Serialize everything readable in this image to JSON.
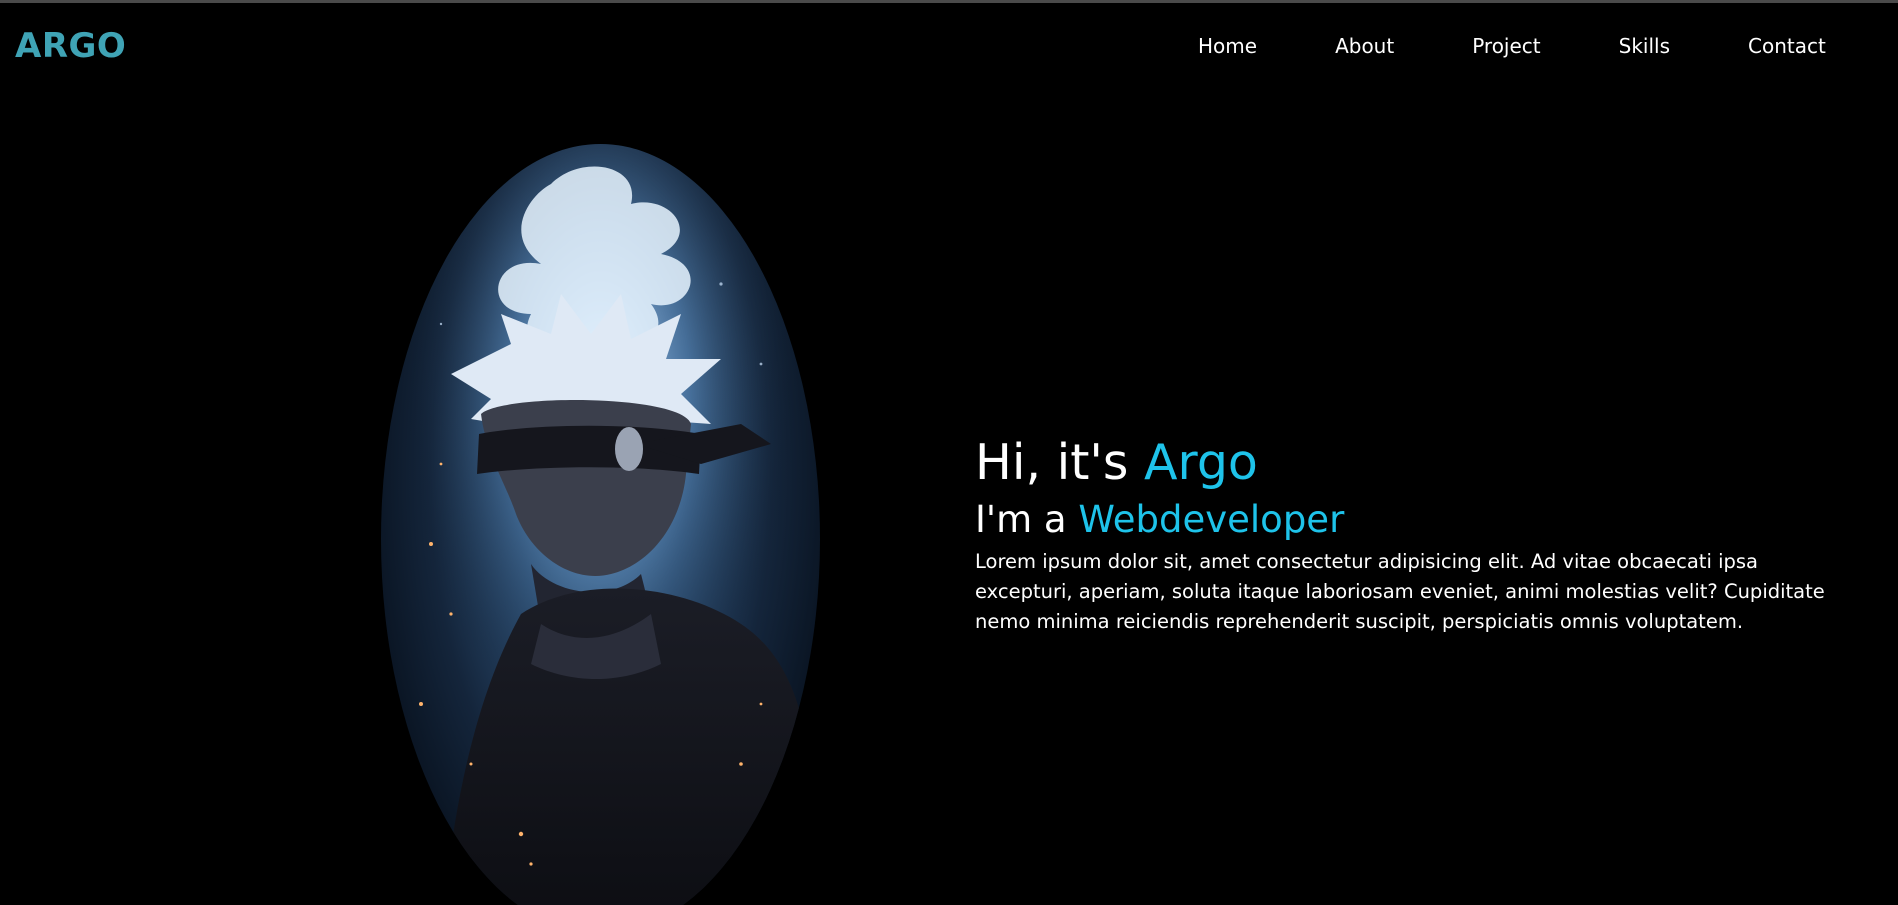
{
  "brand": {
    "logo": "ARGO",
    "color": "#3fa3b5"
  },
  "nav": {
    "items": [
      "Home",
      "About",
      "Project",
      "Skills",
      "Contact"
    ]
  },
  "hero": {
    "title_prefix": "Hi, it's ",
    "title_name": "Argo",
    "subtitle_prefix": "I'm a ",
    "subtitle_role": "Webdeveloper",
    "description": "Lorem ipsum dolor sit, amet consectetur adipisicing elit. Ad vitae obcaecati ipsa excepturi, aperiam, soluta itaque laboriosam eveniet, animi molestias velit? Cupiditate nemo minima reiciendis reprehenderit suscipit, perspiciatis omnis voluptatem.",
    "accent_color": "#1ec3ea"
  },
  "portrait": {
    "icon": "anime-character-portrait"
  },
  "colors": {
    "background": "#000000",
    "text": "#ffffff"
  }
}
